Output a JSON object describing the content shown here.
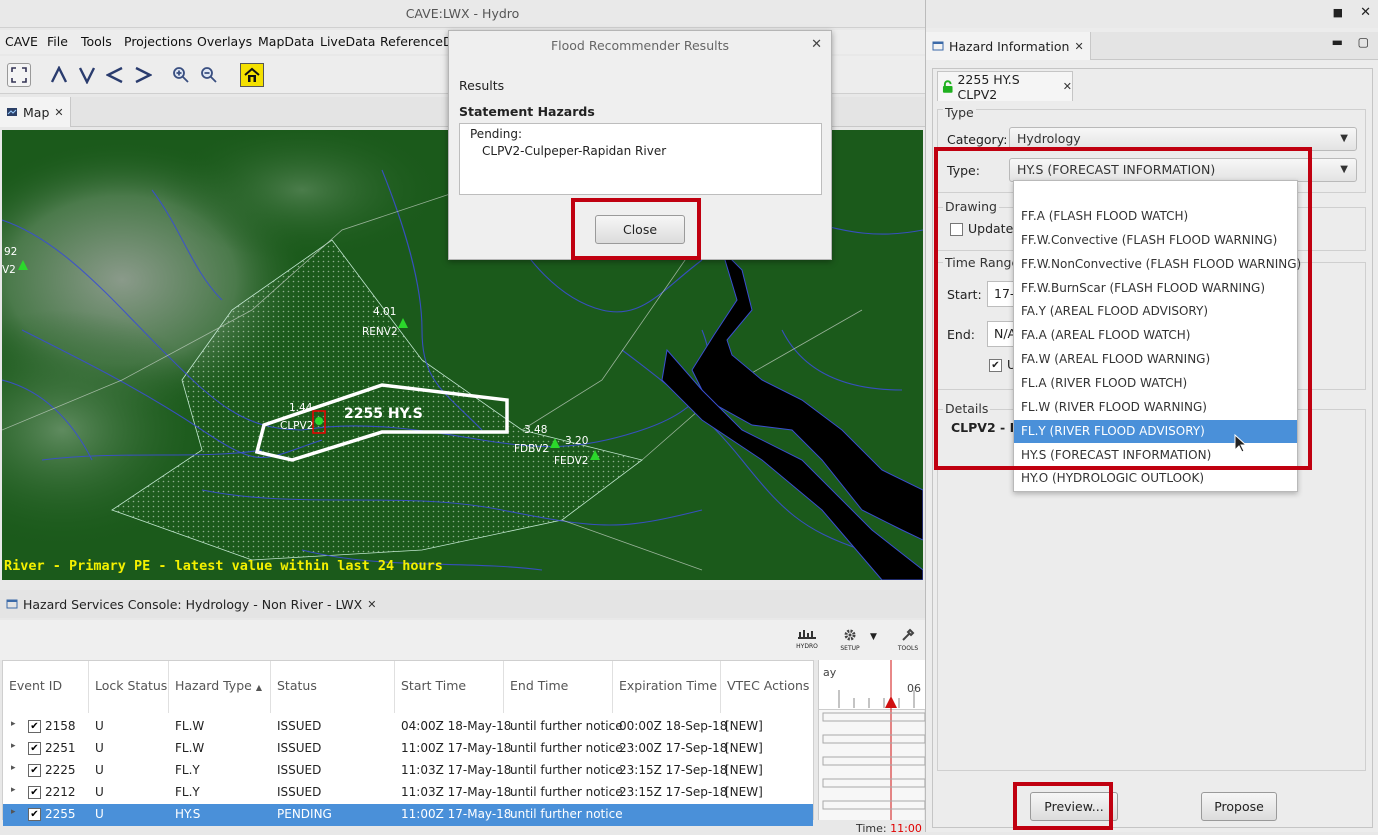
{
  "window": {
    "title": "CAVE:LWX - Hydro"
  },
  "menu": [
    "CAVE",
    "File",
    "Tools",
    "Projections",
    "Overlays",
    "MapData",
    "LiveData",
    "ReferenceDa"
  ],
  "map_tab": {
    "label": "Map"
  },
  "map": {
    "status_text": "River - Primary PE - latest value within last 24 hours",
    "hazard_label": "2255 HY.S",
    "stations": [
      {
        "id": "RENV2",
        "value": "4.01"
      },
      {
        "id": "CLPV2",
        "value": "1.44"
      },
      {
        "id": "FDBV2",
        "value": "3.48"
      },
      {
        "id": "FEDV2",
        "value": "3.20"
      },
      {
        "id": "V2",
        "value": "92"
      }
    ]
  },
  "dialog": {
    "title": "Flood Recommender Results",
    "results_label": "Results",
    "statement_label": "Statement Hazards",
    "pending_label": "Pending:",
    "pending_item": "CLPV2-Culpeper-Rapidan River",
    "close_label": "Close"
  },
  "console": {
    "tab_label": "Hazard Services Console: Hydrology - Non River - LWX",
    "tools": [
      "HYDRO",
      "SETUP",
      "TOOLS"
    ],
    "columns": [
      "Event ID",
      "Lock Status",
      "Hazard Type",
      "Status",
      "Start Time",
      "End Time",
      "Expiration Time",
      "VTEC Actions"
    ],
    "sort_arrow": "▲",
    "rows": [
      {
        "id": "2158",
        "lock": "U",
        "type": "FL.W",
        "status": "ISSUED",
        "start": "04:00Z 18-May-18",
        "end": "until further notice",
        "exp": "00:00Z 18-Sep-18",
        "vtec": "[NEW]",
        "selected": false
      },
      {
        "id": "2251",
        "lock": "U",
        "type": "FL.W",
        "status": "ISSUED",
        "start": "11:00Z 17-May-18",
        "end": "until further notice",
        "exp": "23:00Z 17-Sep-18",
        "vtec": "[NEW]",
        "selected": false
      },
      {
        "id": "2225",
        "lock": "U",
        "type": "FL.Y",
        "status": "ISSUED",
        "start": "11:03Z 17-May-18",
        "end": "until further notice",
        "exp": "23:15Z 17-Sep-18",
        "vtec": "[NEW]",
        "selected": false
      },
      {
        "id": "2212",
        "lock": "U",
        "type": "FL.Y",
        "status": "ISSUED",
        "start": "11:03Z 17-May-18",
        "end": "until further notice",
        "exp": "23:15Z 17-Sep-18",
        "vtec": "[NEW]",
        "selected": false
      },
      {
        "id": "2255",
        "lock": "U",
        "type": "HY.S",
        "status": "PENDING",
        "start": "11:00Z 17-May-18",
        "end": "until further notice",
        "exp": "",
        "vtec": "",
        "selected": true
      }
    ],
    "timeline_label_left": "ay",
    "timeline_label_right": "06",
    "time_prefix": "Time:",
    "time_value": "11:00"
  },
  "hazard_info": {
    "panel_title": "Hazard Information",
    "event_tab": "2255 HY.S CLPV2",
    "type_group": "Type",
    "category_label": "Category:",
    "category_value": "Hydrology",
    "type_label": "Type:",
    "type_value": "HY.S (FORECAST INFORMATION)",
    "drawing_group": "Drawing",
    "update_label": "Update H",
    "time_range_group": "Time Range",
    "start_label": "Start:",
    "start_value": "17-",
    "end_label": "End:",
    "end_value": "N/A",
    "until_label": "U",
    "details_group": "Details",
    "details_value": "CLPV2 - Ra",
    "type_options": [
      "FF.A (FLASH FLOOD WATCH)",
      "FF.W.Convective (FLASH FLOOD WARNING)",
      "FF.W.NonConvective (FLASH FLOOD WARNING)",
      "FF.W.BurnScar (FLASH FLOOD WARNING)",
      "FA.Y (AREAL FLOOD ADVISORY)",
      "FA.A (AREAL FLOOD WATCH)",
      "FA.W (AREAL FLOOD WARNING)",
      "FL.A (RIVER FLOOD WATCH)",
      "FL.W (RIVER FLOOD WARNING)",
      "FL.Y (RIVER FLOOD ADVISORY)",
      "HY.S (FORECAST INFORMATION)",
      "HY.O (HYDROLOGIC OUTLOOK)"
    ],
    "highlighted_option": "FL.Y (RIVER FLOOD ADVISORY)",
    "preview_label": "Preview...",
    "propose_label": "Propose"
  },
  "colors": {
    "accent": "#4a90d9",
    "annotation_red": "#c00010",
    "map_green": "#1b5a1b",
    "status_yellow": "#f4f000"
  }
}
